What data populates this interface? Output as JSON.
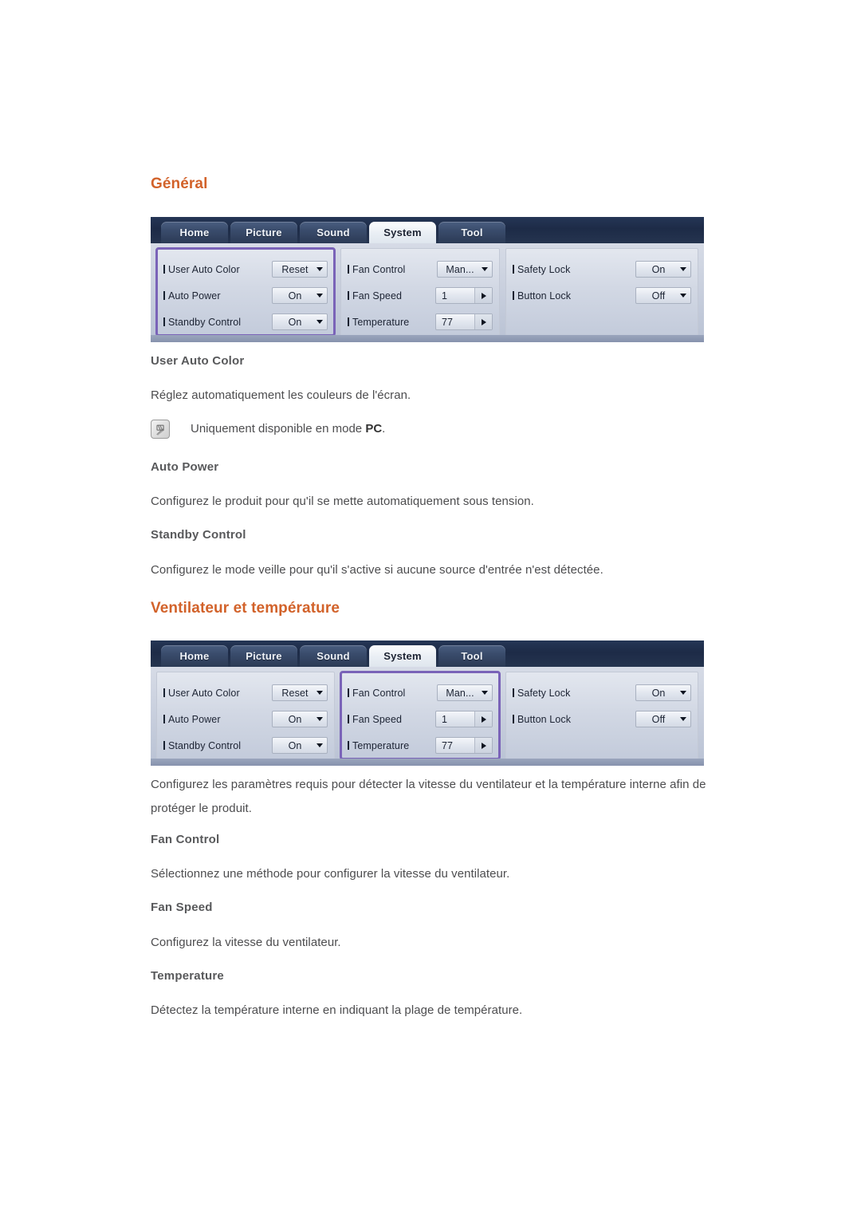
{
  "sections": [
    {
      "heading": "Général",
      "osd": {
        "tabs": [
          {
            "label": "Home",
            "active": false
          },
          {
            "label": "Picture",
            "active": false
          },
          {
            "label": "Sound",
            "active": false
          },
          {
            "label": "System",
            "active": true
          },
          {
            "label": "Tool",
            "active": false
          }
        ],
        "columns": [
          {
            "highlighted": true,
            "rows": [
              {
                "label": "User Auto Color",
                "value": "Reset",
                "control": "dropdown"
              },
              {
                "label": "Auto Power",
                "value": "On",
                "control": "dropdown"
              },
              {
                "label": "Standby Control",
                "value": "On",
                "control": "dropdown"
              }
            ]
          },
          {
            "highlighted": false,
            "rows": [
              {
                "label": "Fan Control",
                "value": "Man...",
                "control": "dropdown"
              },
              {
                "label": "Fan Speed",
                "value": "1",
                "control": "spinner"
              },
              {
                "label": "Temperature",
                "value": "77",
                "control": "spinner"
              }
            ]
          },
          {
            "highlighted": false,
            "rows": [
              {
                "label": "Safety Lock",
                "value": "On",
                "control": "dropdown"
              },
              {
                "label": "Button Lock",
                "value": "Off",
                "control": "dropdown"
              }
            ]
          }
        ]
      },
      "entries": [
        {
          "title": "User Auto Color",
          "body": "Réglez automatiquement les couleurs de l'écran."
        },
        {
          "title": "Auto Power",
          "body": "Configurez le produit pour qu'il se mette automatiquement sous tension."
        },
        {
          "title": "Standby Control",
          "body": "Configurez le mode veille pour qu'il s'active si aucune source d'entrée n'est détectée."
        }
      ],
      "note": {
        "icon": "note-pencil-icon",
        "text_before": "Uniquement disponible en mode ",
        "text_bold": "PC",
        "text_after": "."
      }
    },
    {
      "heading": "Ventilateur et température",
      "osd": {
        "tabs": [
          {
            "label": "Home",
            "active": false
          },
          {
            "label": "Picture",
            "active": false
          },
          {
            "label": "Sound",
            "active": false
          },
          {
            "label": "System",
            "active": true
          },
          {
            "label": "Tool",
            "active": false
          }
        ],
        "columns": [
          {
            "highlighted": false,
            "rows": [
              {
                "label": "User Auto Color",
                "value": "Reset",
                "control": "dropdown"
              },
              {
                "label": "Auto Power",
                "value": "On",
                "control": "dropdown"
              },
              {
                "label": "Standby Control",
                "value": "On",
                "control": "dropdown"
              }
            ]
          },
          {
            "highlighted": true,
            "rows": [
              {
                "label": "Fan Control",
                "value": "Man...",
                "control": "dropdown"
              },
              {
                "label": "Fan Speed",
                "value": "1",
                "control": "spinner"
              },
              {
                "label": "Temperature",
                "value": "77",
                "control": "spinner"
              }
            ]
          },
          {
            "highlighted": false,
            "rows": [
              {
                "label": "Safety Lock",
                "value": "On",
                "control": "dropdown"
              },
              {
                "label": "Button Lock",
                "value": "Off",
                "control": "dropdown"
              }
            ]
          }
        ]
      },
      "intro_line1": "Configurez les paramètres requis pour détecter la vitesse du ventilateur et la température interne afin de",
      "intro_line2": "protéger le produit.",
      "entries": [
        {
          "title": "Fan Control",
          "body": "Sélectionnez une méthode pour configurer la vitesse du ventilateur."
        },
        {
          "title": "Fan Speed",
          "body": "Configurez la vitesse du ventilateur."
        },
        {
          "title": "Temperature",
          "body": "Détectez la température interne en indiquant la plage de température."
        }
      ]
    }
  ],
  "colors": {
    "heading": "#d2622a",
    "body_text": "#4d4d4f",
    "sub_heading": "#58595b",
    "osd_highlight": "#7a63b8",
    "osd_tabbar": "#22314d"
  }
}
